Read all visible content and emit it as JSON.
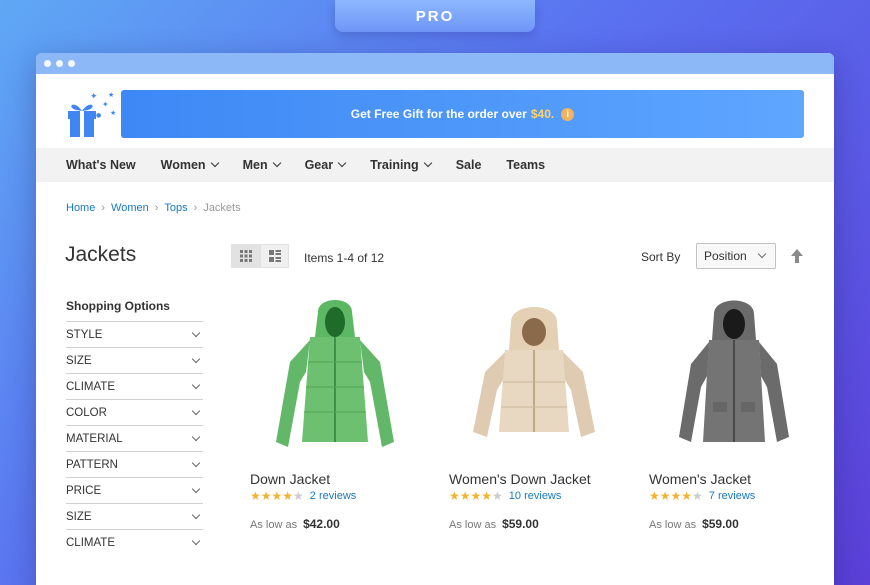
{
  "badge": {
    "label": "PRO"
  },
  "colors": {
    "accent": "#1979c3",
    "promo_start": "#3d88f5",
    "promo_end": "#5ea6ff",
    "star": "#f5b230"
  },
  "promo": {
    "text": "Get Free Gift for the order over",
    "amount": "$40.",
    "info_icon": "info-icon"
  },
  "logo": {
    "icon": "gift-box-icon"
  },
  "nav": {
    "items": [
      {
        "label": "What's New",
        "dropdown": false
      },
      {
        "label": "Women",
        "dropdown": true
      },
      {
        "label": "Men",
        "dropdown": true
      },
      {
        "label": "Gear",
        "dropdown": true
      },
      {
        "label": "Training",
        "dropdown": true
      },
      {
        "label": "Sale",
        "dropdown": false
      },
      {
        "label": "Teams",
        "dropdown": false
      }
    ]
  },
  "breadcrumb": [
    {
      "label": "Home",
      "link": true
    },
    {
      "label": "Women",
      "link": true
    },
    {
      "label": "Tops",
      "link": true
    },
    {
      "label": "Jackets",
      "link": false
    }
  ],
  "page": {
    "title": "Jackets"
  },
  "toolbar": {
    "items_count": "Items 1-4 of 12",
    "sort_label": "Sort By",
    "sort_value": "Position",
    "view_modes": [
      "grid-view-icon",
      "list-view-icon"
    ],
    "sort_direction_icon": "arrow-up-icon"
  },
  "sidebar": {
    "title": "Shopping Options",
    "filters": [
      "STYLE",
      "SIZE",
      "CLIMATE",
      "COLOR",
      "MATERIAL",
      "PATTERN",
      "PRICE",
      "SIZE",
      "CLIMATE"
    ]
  },
  "products": [
    {
      "name": "Down Jacket",
      "rating": 4,
      "reviews": "2 reviews",
      "as_low_as": "As low as",
      "price": "$42.00",
      "color": "#6cc070"
    },
    {
      "name": "Women's Down Jacket",
      "rating": 4,
      "reviews": "10 reviews",
      "as_low_as": "As low as",
      "price": "$59.00",
      "color": "#e6d6c0"
    },
    {
      "name": "Women's Jacket",
      "rating": 4,
      "reviews": "7 reviews",
      "as_low_as": "As low as",
      "price": "$59.00",
      "color": "#6e6e6e"
    }
  ]
}
